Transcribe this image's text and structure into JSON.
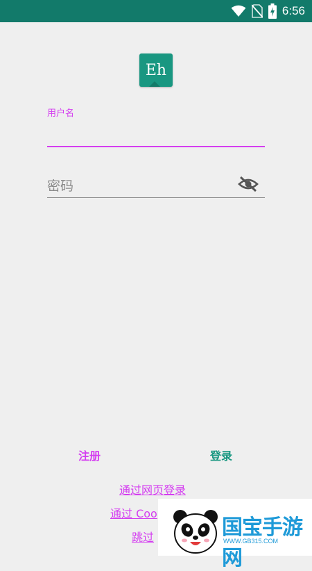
{
  "status_bar": {
    "time": "6:56",
    "icons": [
      "wifi-icon",
      "no-sim-icon",
      "battery-charging-icon"
    ]
  },
  "app": {
    "logo_text": "Eh",
    "accent_color": "#d43ef0",
    "brand_color": "#199781"
  },
  "form": {
    "username_label": "用户名",
    "username_value": "",
    "password_placeholder": "密码",
    "password_value": ""
  },
  "actions": {
    "register_label": "注册",
    "login_label": "登录"
  },
  "links": {
    "web_login": "通过网页登录",
    "cookie_login": "通过 Coo",
    "skip": "跳过"
  },
  "watermark": {
    "brand": "国宝手游网",
    "url": "WWW.GB315.COM"
  }
}
